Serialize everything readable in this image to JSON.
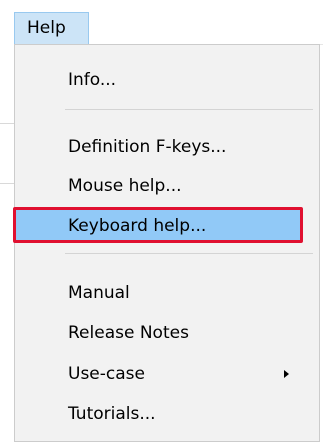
{
  "menubar": {
    "help_label": "Help"
  },
  "menu": {
    "items": [
      {
        "label": "Info..."
      },
      {
        "label": "Definition F-keys..."
      },
      {
        "label": "Mouse help..."
      },
      {
        "label": "Keyboard help..."
      },
      {
        "label": "Manual"
      },
      {
        "label": "Release Notes"
      },
      {
        "label": "Use-case"
      },
      {
        "label": "Tutorials..."
      }
    ]
  },
  "colors": {
    "menubar_highlight": "#cce4f7",
    "dropdown_background": "#f2f2f2",
    "item_highlight": "#91c9f7",
    "annotation_outline": "#e01030"
  },
  "icons": {
    "submenu_arrow": "chevron-right-icon"
  }
}
